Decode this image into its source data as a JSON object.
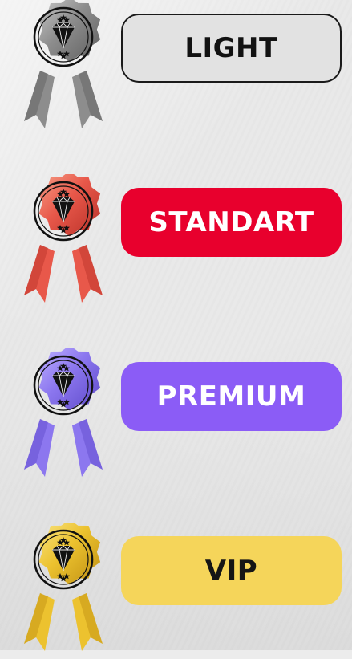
{
  "tiers": [
    {
      "label": "LIGHT",
      "button_color": "#e2e2e2",
      "medal": {
        "icon": "diamond-award-medal-icon",
        "primary": "#8d8d8d",
        "light": "#c9c9c9",
        "dark": "#5e5e5e"
      }
    },
    {
      "label": "STANDART",
      "button_color": "#e8002d",
      "medal": {
        "icon": "diamond-award-medal-icon",
        "primary": "#e8584a",
        "light": "#f7a28a",
        "dark": "#b83028"
      }
    },
    {
      "label": "PREMIUM",
      "button_color": "#8b5cf6",
      "medal": {
        "icon": "diamond-award-medal-icon",
        "primary": "#8c77ef",
        "light": "#c0b3ff",
        "dark": "#5d49c9"
      }
    },
    {
      "label": "VIP",
      "button_color": "#f5d55a",
      "medal": {
        "icon": "diamond-award-medal-icon",
        "primary": "#ecc22f",
        "light": "#fae585",
        "dark": "#bf8f12"
      }
    }
  ]
}
